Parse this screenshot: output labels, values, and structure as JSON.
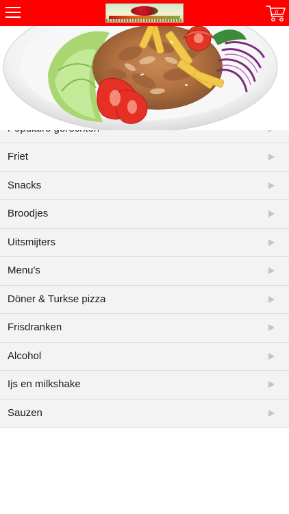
{
  "header": {
    "background_color": "#ff0000",
    "menu_icon": "hamburger-menu-icon",
    "logo": "restaurant-logo",
    "cart_icon": "shopping-cart-icon",
    "cart_count": "0"
  },
  "hero": {
    "image": "doner-plate-with-fries-and-salad"
  },
  "categories": {
    "arrow_icon": "triangle-right-icon",
    "items": [
      {
        "label": "Populaire gerechten"
      },
      {
        "label": "Friet"
      },
      {
        "label": "Snacks"
      },
      {
        "label": "Broodjes"
      },
      {
        "label": "Uitsmijters"
      },
      {
        "label": "Menu's"
      },
      {
        "label": "Döner & Turkse pizza"
      },
      {
        "label": "Frisdranken"
      },
      {
        "label": "Alcohol"
      },
      {
        "label": "Ijs en milkshake"
      },
      {
        "label": "Sauzen"
      }
    ]
  }
}
